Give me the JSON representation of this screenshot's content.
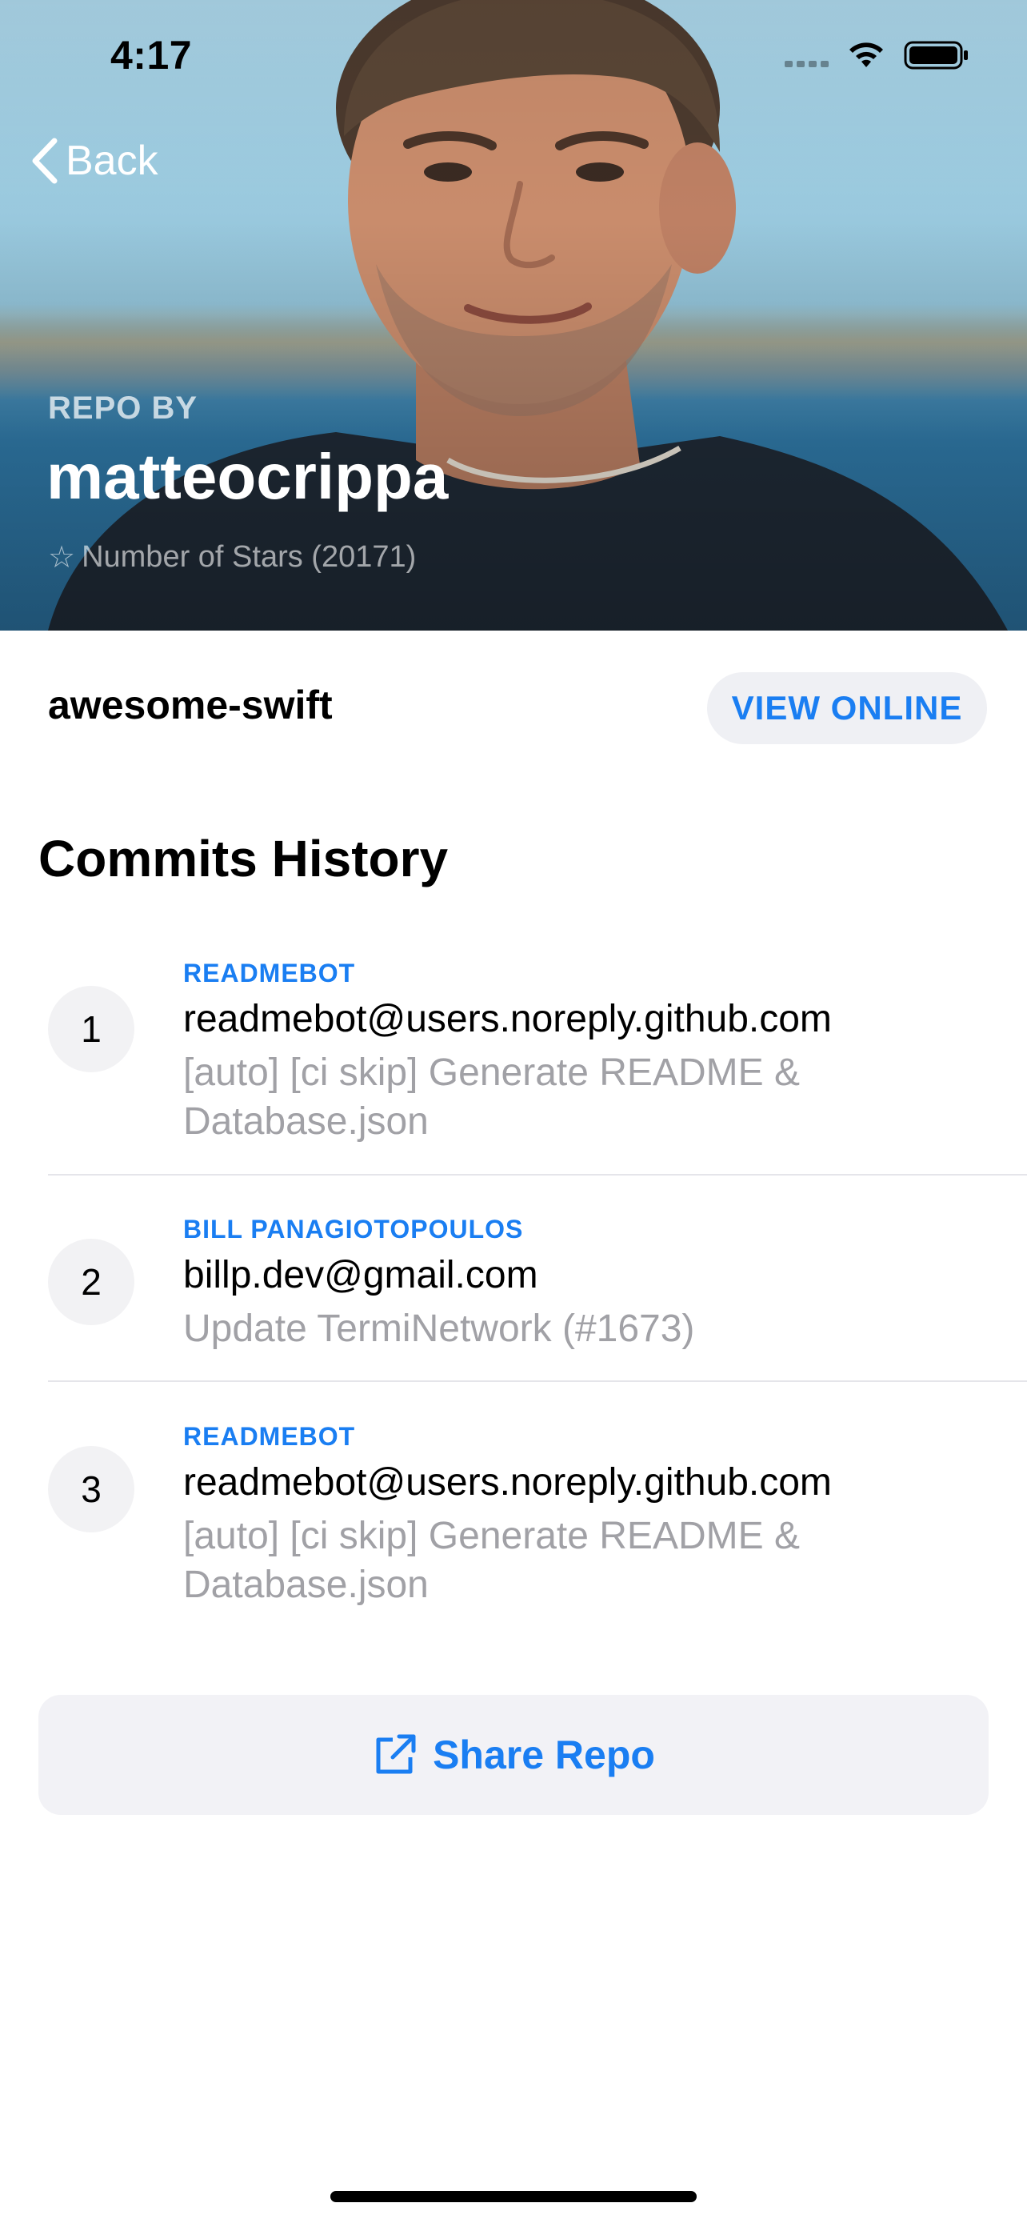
{
  "status_bar": {
    "time": "4:17",
    "icons": [
      "cellular-signal-icon",
      "wifi-icon",
      "battery-icon"
    ]
  },
  "nav": {
    "back_label": "Back",
    "back_icon": "chevron-left-icon"
  },
  "header": {
    "repo_by_label": "REPO BY",
    "owner": "matteocrippa",
    "stars_icon": "star-outline-icon",
    "stars_text": "Number of Stars (20171)"
  },
  "repo": {
    "name": "awesome-swift",
    "view_online_label": "VIEW ONLINE"
  },
  "commits": {
    "title": "Commits History",
    "items": [
      {
        "index": "1",
        "author": "READMEBOT",
        "email": "readmebot@users.noreply.github.com",
        "message": "[auto] [ci skip] Generate README & Database.json"
      },
      {
        "index": "2",
        "author": "BILL PANAGIOTOPOULOS",
        "email": "billp.dev@gmail.com",
        "message": "Update TermiNetwork (#1673)"
      },
      {
        "index": "3",
        "author": "READMEBOT",
        "email": "readmebot@users.noreply.github.com",
        "message": "[auto] [ci skip] Generate README & Database.json"
      }
    ]
  },
  "share": {
    "label": "Share Repo",
    "icon": "share-external-icon"
  },
  "colors": {
    "accent": "#1a7ef2",
    "secondary_text": "#a1a1a6",
    "pill_background": "#eff0f4"
  }
}
